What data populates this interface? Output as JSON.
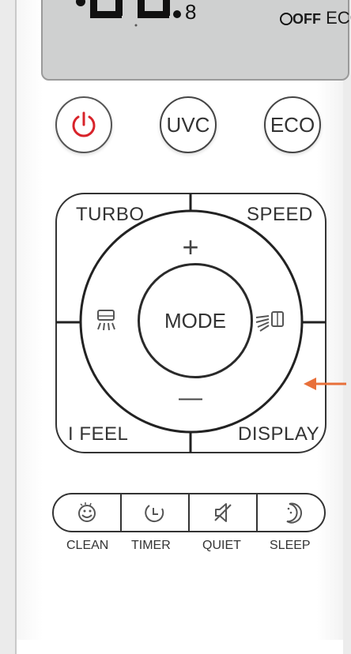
{
  "lcd": {
    "off_label": "OFF",
    "eco_label": "ECO"
  },
  "buttons": {
    "power": {
      "icon": "power-icon",
      "color": "#d8232a"
    },
    "uvc": {
      "label": "UVC"
    },
    "eco": {
      "label": "ECO"
    }
  },
  "pad": {
    "turbo": "TURBO",
    "speed": "SPEED",
    "plus": "+",
    "minus": "—",
    "mode": "MODE",
    "ifeel": "I FEEL",
    "display": "DISPLAY",
    "left_icon": "vertical-swing-icon",
    "right_icon": "horizontal-swing-icon"
  },
  "bottom": [
    {
      "label": "CLEAN",
      "icon": "clean-icon"
    },
    {
      "label": "TIMER",
      "icon": "timer-icon"
    },
    {
      "label": "QUIET",
      "icon": "quiet-icon"
    },
    {
      "label": "SLEEP",
      "icon": "sleep-icon"
    }
  ],
  "annotation": {
    "arrow_color": "#e8703a"
  }
}
